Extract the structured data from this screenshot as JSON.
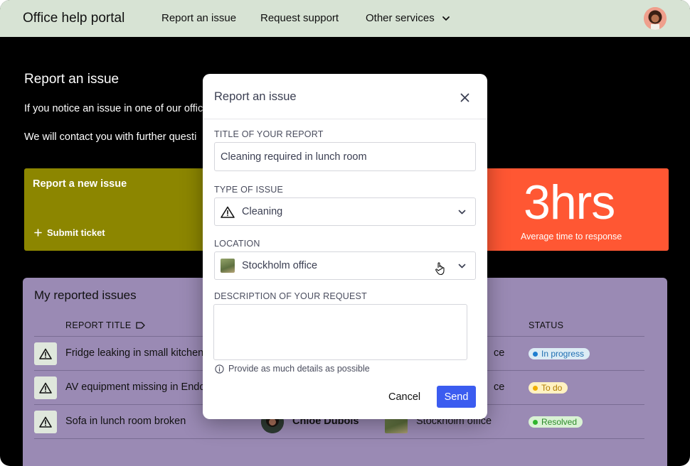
{
  "header": {
    "brand": "Office help portal",
    "nav": [
      "Report an issue",
      "Request support",
      "Other services"
    ]
  },
  "page": {
    "title": "Report an issue",
    "intro_1": "If you notice an issue in one of our offic",
    "intro_2": "We will contact you with further questi"
  },
  "cards": {
    "new_issue": {
      "title": "Report a new issue",
      "action": "Submit ticket",
      "color": "#8c8600"
    },
    "response_time": {
      "value": "3hrs",
      "label": "Average time to response",
      "color": "#ff5733"
    }
  },
  "issues": {
    "title": "My  reported issues",
    "columns": {
      "title": "REPORT TITLE",
      "status": "STATUS"
    },
    "rows": [
      {
        "title": "Fridge leaking in small kitchen",
        "assignee": "",
        "location": "ce",
        "status": "In progress",
        "icon": "warning-icon"
      },
      {
        "title": "AV equipment missing in Endo",
        "assignee": "",
        "location": "ce",
        "status": "To do",
        "icon": "warning-icon"
      },
      {
        "title": "Sofa in lunch room broken",
        "assignee": "Chloe Dubois",
        "location": "Stockholm office",
        "status": "Resolved",
        "icon": "warning-icon"
      }
    ]
  },
  "modal": {
    "title": "Report an issue",
    "fields": {
      "title_label": "TITLE OF YOUR REPORT",
      "title_value": "Cleaning required in lunch room",
      "type_label": "TYPE OF ISSUE",
      "type_value": "Cleaning",
      "location_label": "LOCATION",
      "location_value": "Stockholm office",
      "description_label": "DESCRIPTION OF YOUR REQUEST",
      "description_value": ""
    },
    "help_text": "Provide as much details as possible",
    "cancel": "Cancel",
    "send": "Send",
    "send_color": "#3b5cf0"
  }
}
